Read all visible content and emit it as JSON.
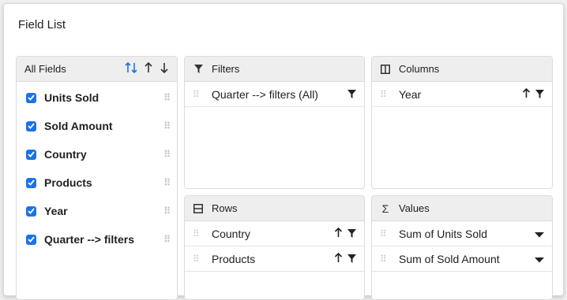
{
  "dialog": {
    "title": "Field List"
  },
  "all_fields": {
    "title": "All Fields",
    "items": [
      {
        "label": "Units Sold",
        "checked": true
      },
      {
        "label": "Sold Amount",
        "checked": true
      },
      {
        "label": "Country",
        "checked": true
      },
      {
        "label": "Products",
        "checked": true
      },
      {
        "label": "Year",
        "checked": true
      },
      {
        "label": "Quarter --> filters",
        "checked": true
      }
    ]
  },
  "filters": {
    "title": "Filters",
    "items": [
      {
        "label": "Quarter --> filters (All)"
      }
    ]
  },
  "columns": {
    "title": "Columns",
    "items": [
      {
        "label": "Year"
      }
    ]
  },
  "rows": {
    "title": "Rows",
    "items": [
      {
        "label": "Country"
      },
      {
        "label": "Products"
      }
    ]
  },
  "values": {
    "title": "Values",
    "items": [
      {
        "label": "Sum of Units Sold"
      },
      {
        "label": "Sum of Sold Amount"
      }
    ]
  },
  "colors": {
    "accent": "#1a73e8",
    "header_bg": "#eeeeee",
    "border": "#dcdcdc"
  },
  "icons": {
    "filters": "filter-icon",
    "columns": "columns-icon",
    "rows": "rows-icon",
    "values": "sigma-icon",
    "sort": "sort-toggle-icon",
    "asc": "arrow-up-icon",
    "desc": "arrow-down-icon",
    "item_filter": "filter-icon",
    "item_sort": "arrow-up-icon",
    "dropdown": "caret-down-icon",
    "drag": "drag-handle-icon",
    "check": "checkbox-checked-icon"
  }
}
